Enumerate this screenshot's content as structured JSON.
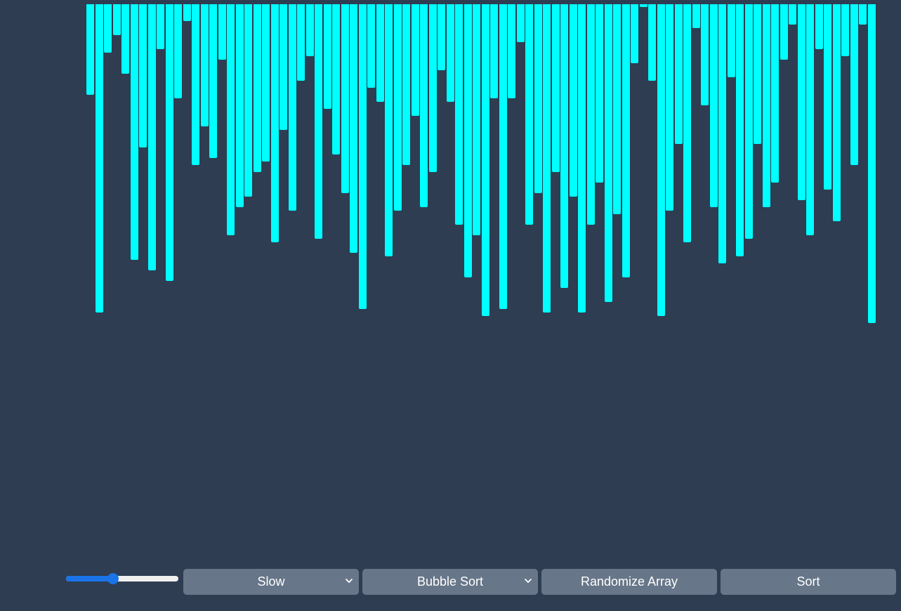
{
  "colors": {
    "background": "#2e3d51",
    "bar": "#00ffff",
    "control_bg": "#677688",
    "slider_accent": "#1a73e8"
  },
  "array": {
    "values": [
      125,
      435,
      65,
      40,
      95,
      360,
      200,
      375,
      60,
      390,
      130,
      20,
      225,
      170,
      215,
      75,
      325,
      285,
      270,
      235,
      220,
      335,
      175,
      290,
      105,
      70,
      330,
      145,
      210,
      265,
      350,
      430,
      115,
      135,
      355,
      290,
      225,
      155,
      285,
      235,
      90,
      135,
      310,
      385,
      325,
      440,
      130,
      430,
      130,
      50,
      310,
      265,
      435,
      235,
      400,
      270,
      435,
      310,
      250,
      420,
      295,
      385,
      80,
      0,
      105,
      440,
      290,
      195,
      335,
      30,
      140,
      285,
      365,
      100,
      355,
      330,
      195,
      285,
      250,
      75,
      25,
      275,
      325,
      60,
      260,
      305,
      70,
      225,
      25,
      450
    ],
    "max": 450
  },
  "controls": {
    "speed_slider": {
      "value": 0.42
    },
    "speed_select": {
      "selected": "Slow"
    },
    "algorithm_select": {
      "selected": "Bubble Sort"
    },
    "randomize_label": "Randomize Array",
    "sort_label": "Sort"
  }
}
